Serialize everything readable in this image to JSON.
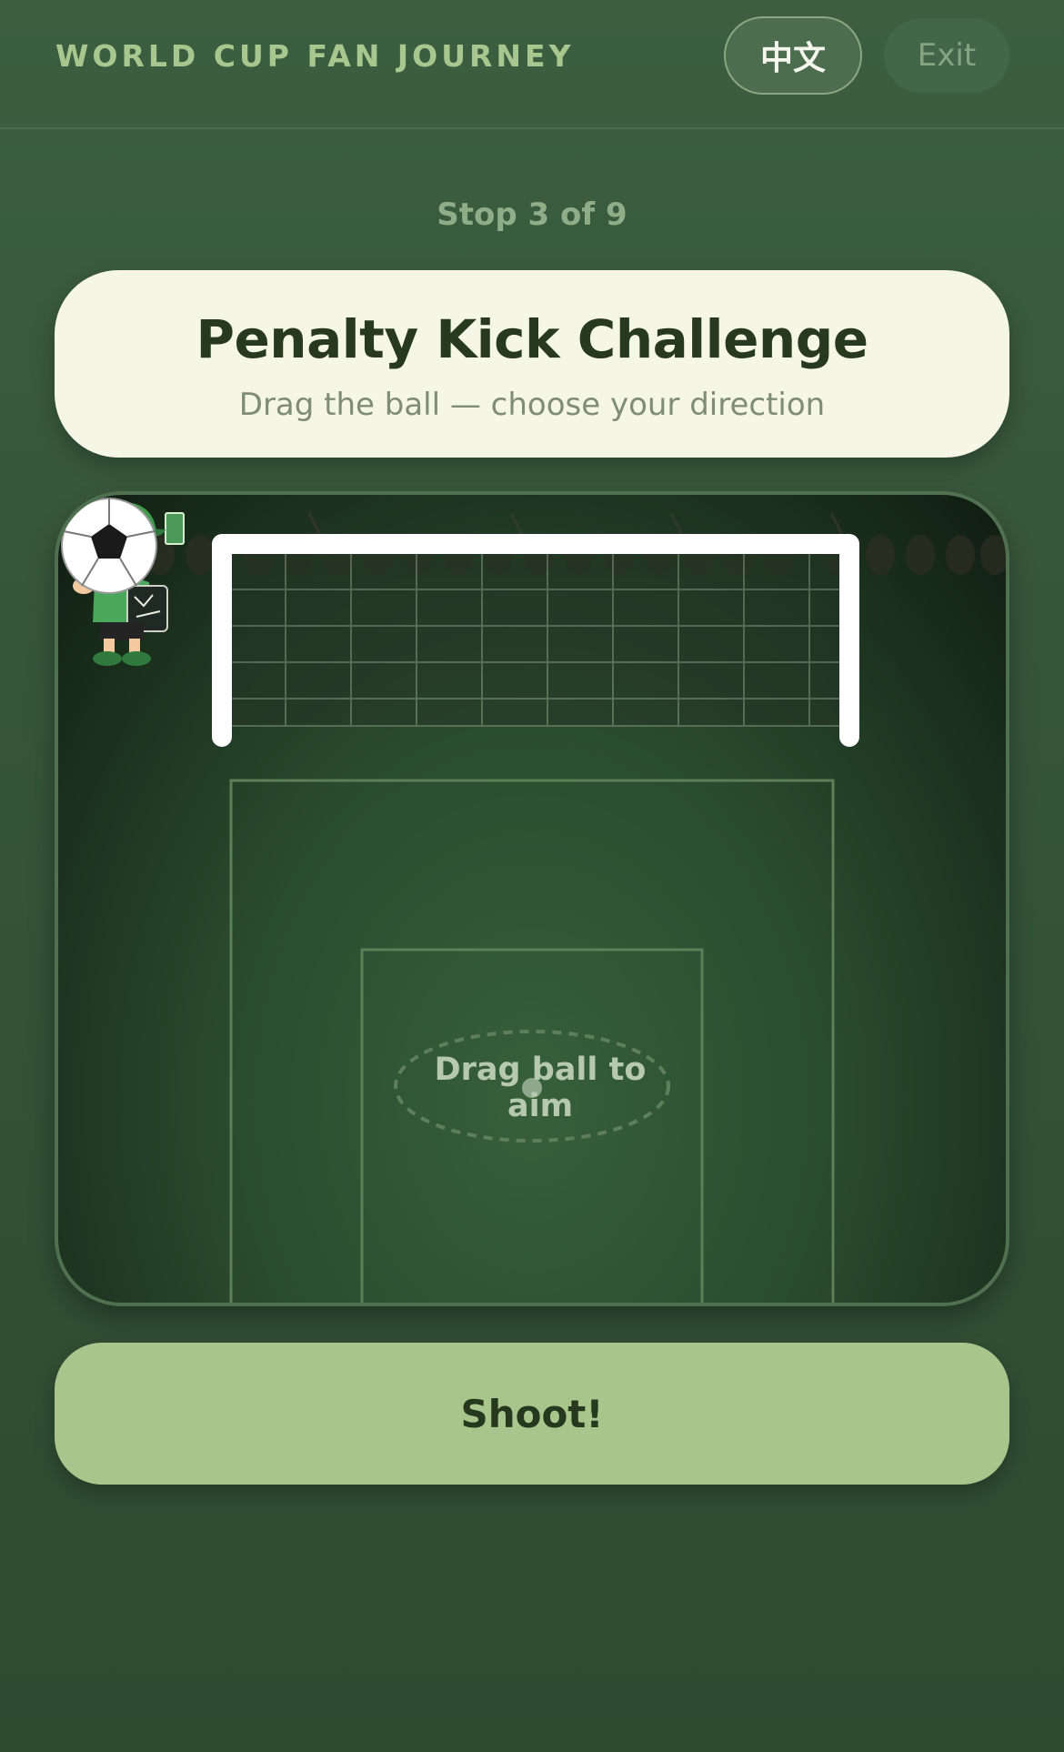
{
  "header": {
    "brand": "WORLD CUP FAN JOURNEY",
    "lang_label": "中文",
    "exit_label": "Exit"
  },
  "progress": {
    "stop_text": "Stop 3 of 9",
    "current": 3,
    "total": 9
  },
  "challenge": {
    "title": "Penalty Kick Challenge",
    "subtitle": "Drag the ball — choose your direction"
  },
  "pitch": {
    "hint": "Drag ball to aim",
    "keeper_icon": "goalkeeper-mascot-icon",
    "ball_icon": "soccer-ball-icon"
  },
  "actions": {
    "shoot_label": "Shoot!"
  },
  "colors": {
    "background": "#35553a",
    "accent": "#a8c68c",
    "card": "#f6f6e6",
    "text_dark": "#27391f"
  }
}
